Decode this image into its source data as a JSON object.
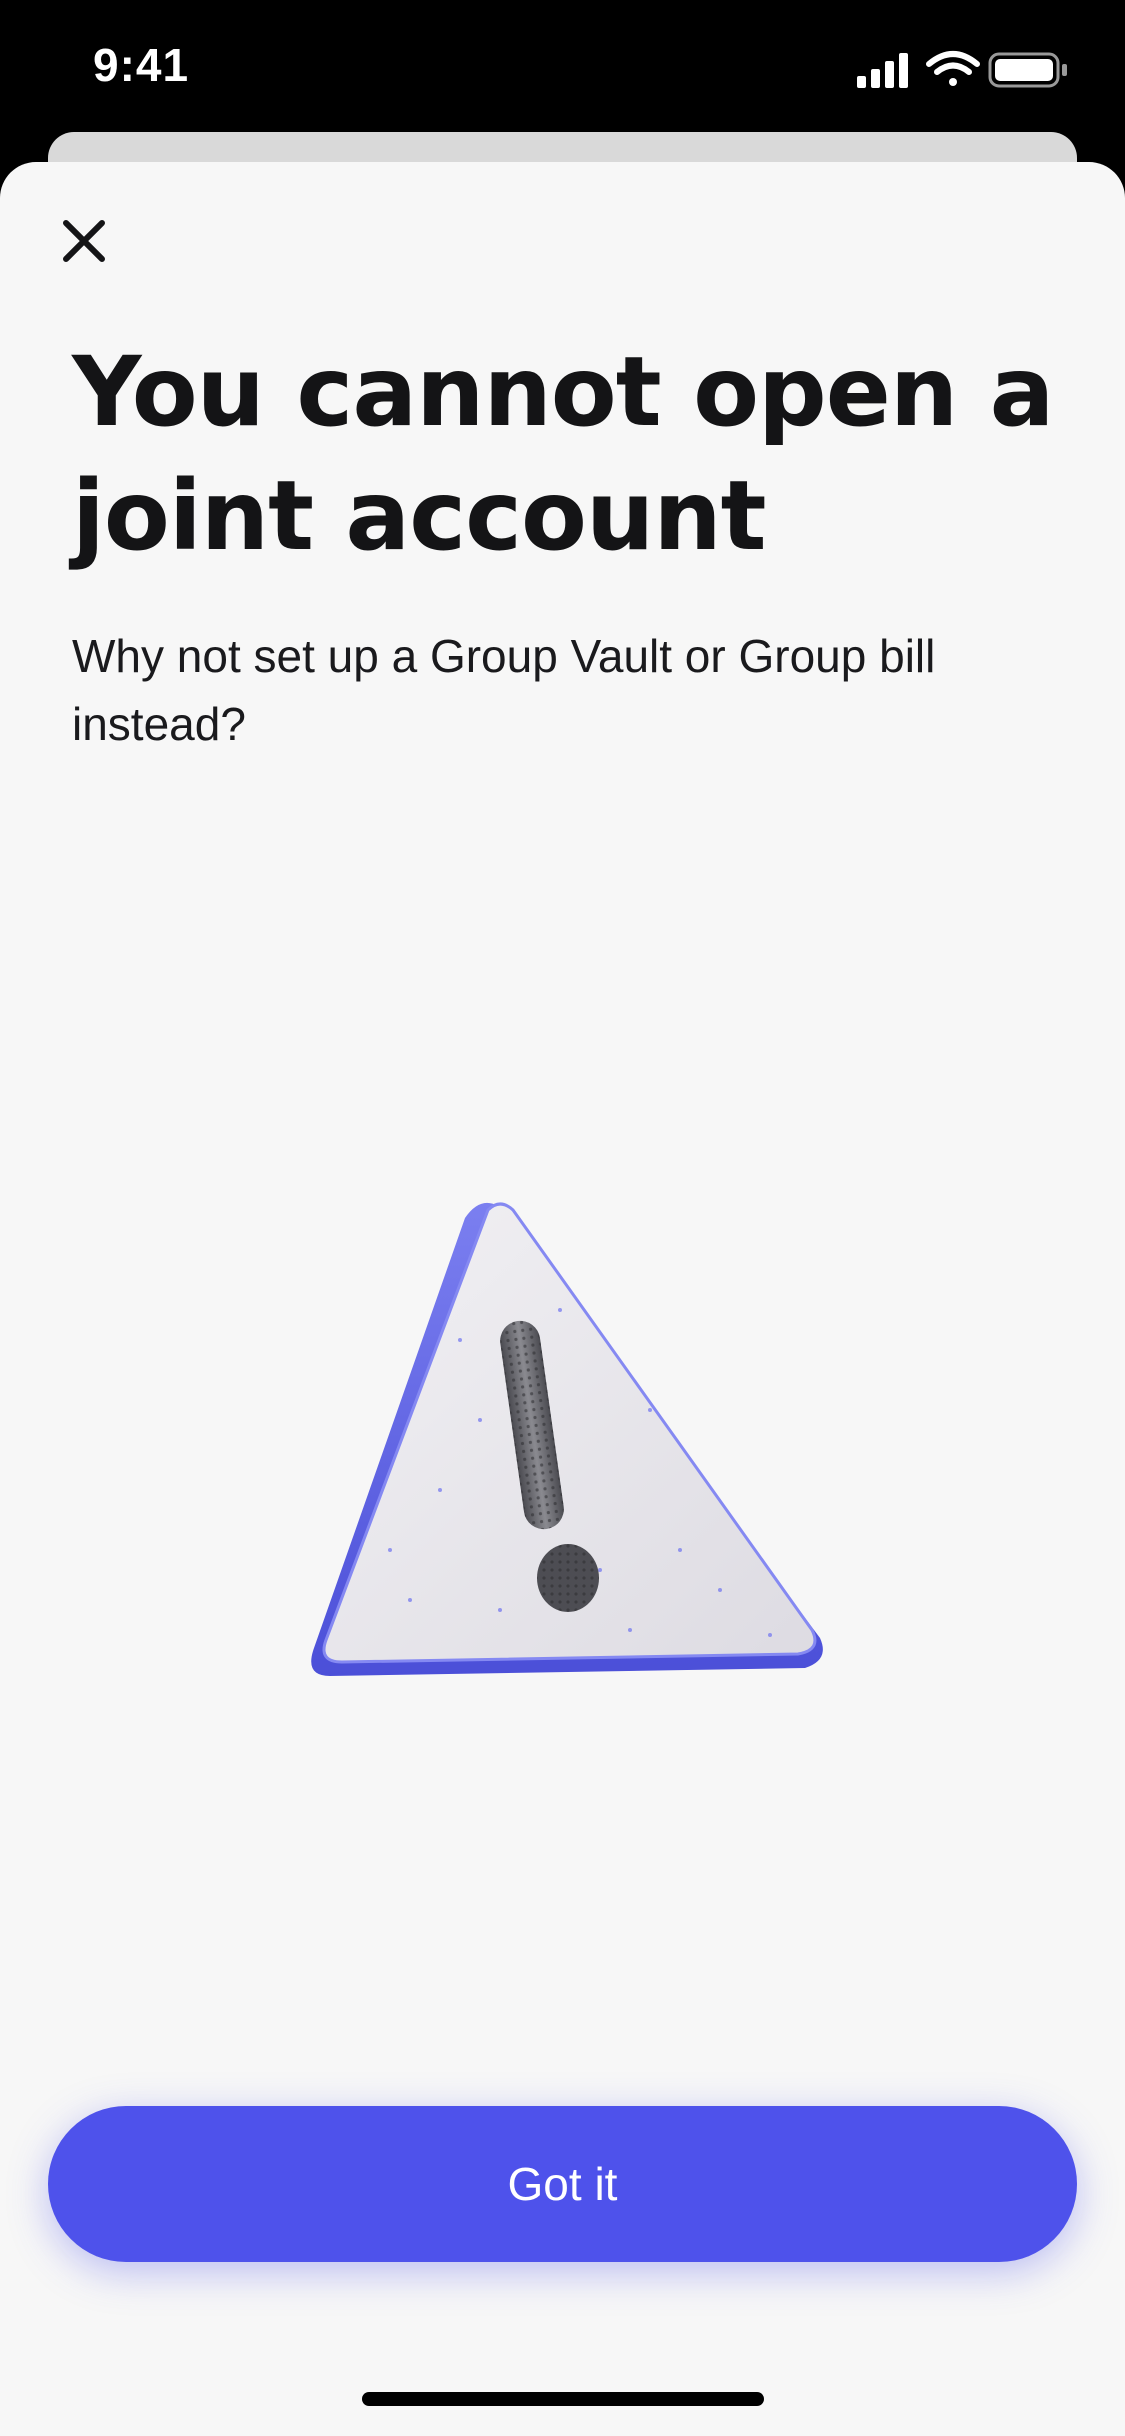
{
  "status_bar": {
    "time": "9:41",
    "icons": [
      "cellular-signal-icon",
      "wifi-icon",
      "battery-icon"
    ]
  },
  "header": {
    "close_icon": "close-icon"
  },
  "main": {
    "title": "You cannot open a joint account",
    "subtitle": "Why not set up a Group Vault or Group bill instead?",
    "illustration_icon": "warning-triangle-icon"
  },
  "footer": {
    "primary_button_label": "Got it"
  },
  "colors": {
    "accent": "#4e52eb",
    "background": "#f7f7f7",
    "title_text": "#141416"
  }
}
